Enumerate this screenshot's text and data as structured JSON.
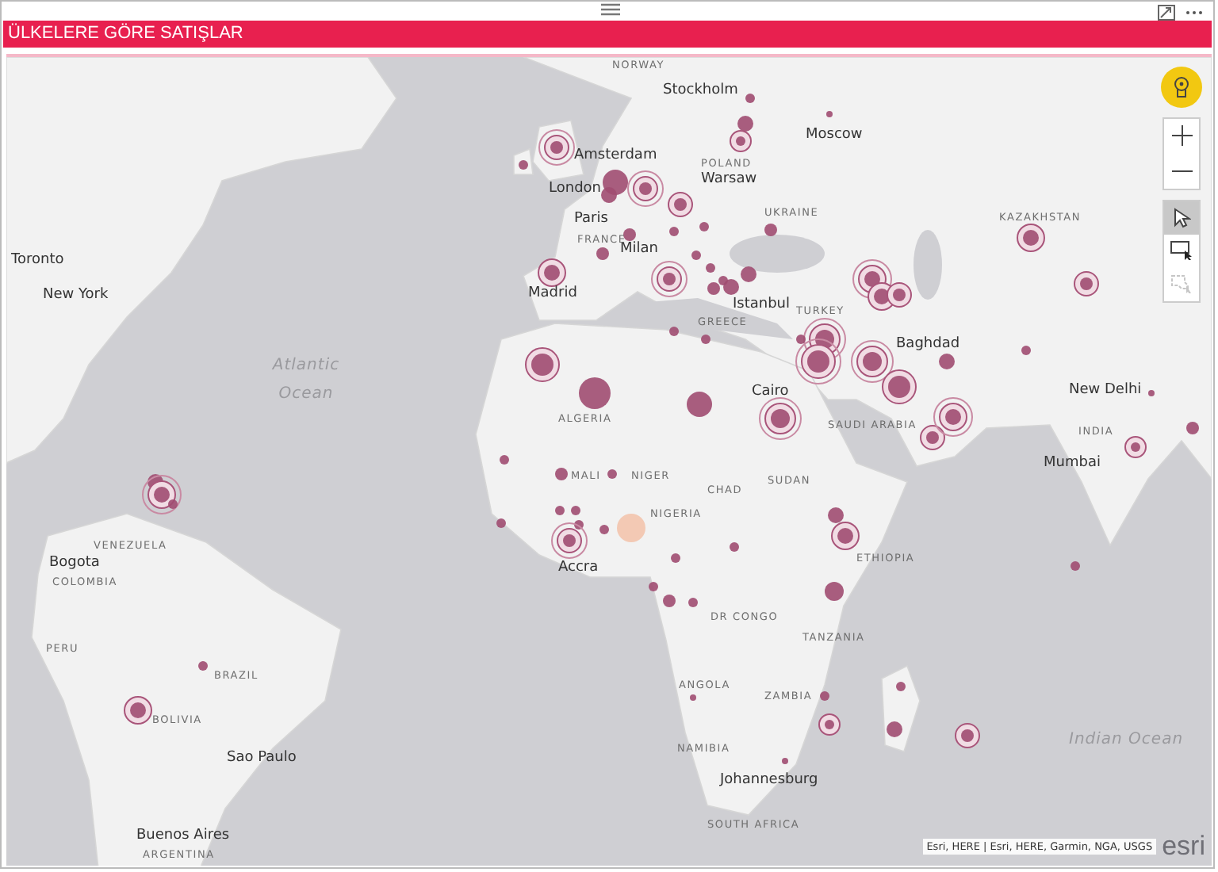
{
  "visual": {
    "title": "ÜLKELERE GÖRE SATIŞLAR"
  },
  "cities": [
    "Stockholm",
    "Moscow",
    "Amsterdam",
    "London",
    "Warsaw",
    "Paris",
    "Milan",
    "Toronto",
    "New York",
    "Madrid",
    "Istanbul",
    "Cairo",
    "Baghdad",
    "New Delhi",
    "Mumbai",
    "Accra",
    "Bogota",
    "Sao Paulo",
    "Johannesburg",
    "Buenos Aires"
  ],
  "countries": [
    "NORWAY",
    "POLAND",
    "UKRAINE",
    "KAZAKHSTAN",
    "FRANCE",
    "GREECE",
    "TURKEY",
    "SAUDI ARABIA",
    "INDIA",
    "ALGERIA",
    "MALI",
    "NIGER",
    "CHAD",
    "SUDAN",
    "NIGERIA",
    "ETHIOPIA",
    "VENEZUELA",
    "COLOMBIA",
    "PERU",
    "BRAZIL",
    "BOLIVIA",
    "DR CONGO",
    "TANZANIA",
    "ANGOLA",
    "ZAMBIA",
    "NAMIBIA",
    "SOUTH AFRICA",
    "ARGENTINA"
  ],
  "oceans": [
    "Atlantic Ocean",
    "Indian Ocean"
  ],
  "tools": [
    {
      "kind": "pointer",
      "selected": true,
      "disabled": false
    },
    {
      "kind": "rectangle",
      "selected": false,
      "disabled": false
    },
    {
      "kind": "lasso",
      "selected": false,
      "disabled": true
    }
  ],
  "attribution": "Esri, HERE | Esri, HERE, Garmin, NGA, USGS",
  "logo": "esri"
}
